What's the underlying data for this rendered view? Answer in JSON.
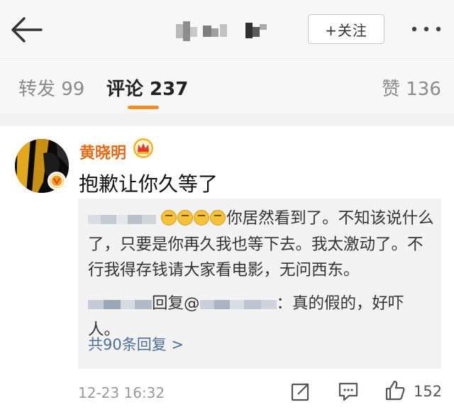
{
  "header": {
    "follow_label": "+关注",
    "icons": {
      "back": "back-arrow-icon",
      "more": "more-dots-icon"
    }
  },
  "tabs": {
    "repost": "转发 99",
    "comments": "评论 237",
    "likes": "赞 136",
    "active": "comments",
    "accent_color": "#f08f24"
  },
  "comment": {
    "username": "黄晓明",
    "username_color": "#e76a17",
    "badge_icon": "crown-icon",
    "verified_icon": "verified-v-icon",
    "text": "抱歉让你久等了",
    "replies": [
      {
        "emoji_count": 4,
        "text": "你居然看到了。不知该说什么了，只要是你再久我也等下去。我太激动了。不行我得存钱请大家看电影，无问西东。"
      },
      {
        "action": "回复@",
        "text": "：真的假的，好吓人。"
      }
    ],
    "more_replies": "共90条回复 >",
    "more_replies_color": "#4d6f96",
    "timestamp": "12-23 16:32",
    "likes": "152",
    "action_icons": [
      "share-icon",
      "reply-icon",
      "like-icon"
    ]
  }
}
